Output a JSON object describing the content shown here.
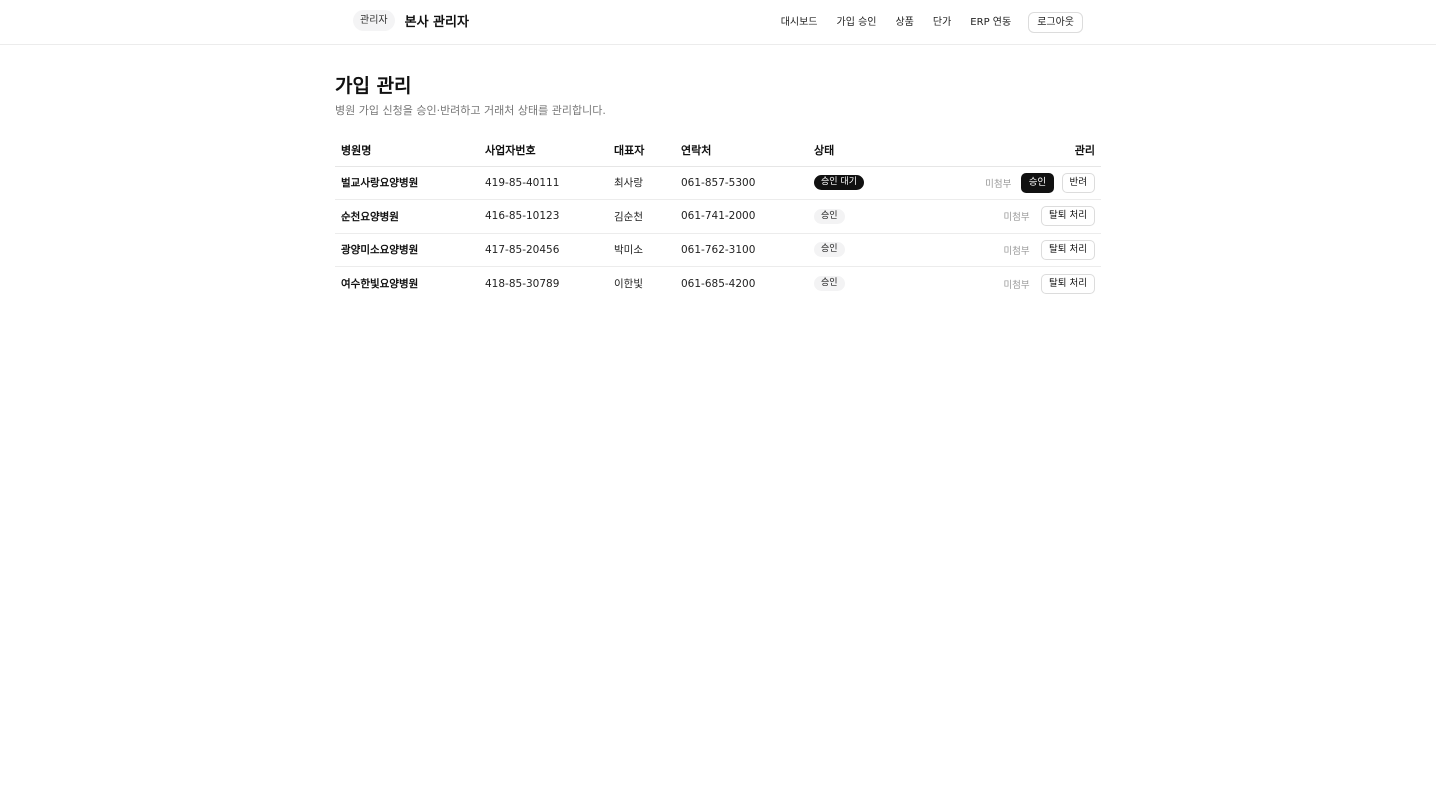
{
  "header": {
    "role_badge": "관리자",
    "title": "본사 관리자",
    "nav": [
      "대시보드",
      "가입 승인",
      "상품",
      "단가",
      "ERP 연동"
    ],
    "logout_label": "로그아웃"
  },
  "page": {
    "title": "가입 관리",
    "subtitle": "병원 가입 신청을 승인·반려하고 거래처 상태를 관리합니다."
  },
  "table": {
    "columns": [
      "병원명",
      "사업자번호",
      "대표자",
      "연락처",
      "상태",
      "관리"
    ],
    "rows": [
      {
        "name": "벌교사랑요양병원",
        "bizno": "419-85-40111",
        "ceo": "최사랑",
        "phone": "061-857-5300",
        "status": "승인 대기",
        "attachment": "미첨부",
        "actions": [
          "승인",
          "반려"
        ]
      },
      {
        "name": "순천요양병원",
        "bizno": "416-85-10123",
        "ceo": "김순천",
        "phone": "061-741-2000",
        "status": "승인",
        "attachment": "미첨부",
        "actions": [
          "탈퇴 처리"
        ]
      },
      {
        "name": "광양미소요양병원",
        "bizno": "417-85-20456",
        "ceo": "박미소",
        "phone": "061-762-3100",
        "status": "승인",
        "attachment": "미첨부",
        "actions": [
          "탈퇴 처리"
        ]
      },
      {
        "name": "여수한빛요양병원",
        "bizno": "418-85-30789",
        "ceo": "이한빛",
        "phone": "061-685-4200",
        "status": "승인",
        "attachment": "미첨부",
        "actions": [
          "탈퇴 처리"
        ]
      }
    ]
  },
  "colors": {
    "pending_badge_bg": "#111111",
    "approved_badge_bg": "#f3f3f4",
    "primary_button_bg": "#111111"
  }
}
